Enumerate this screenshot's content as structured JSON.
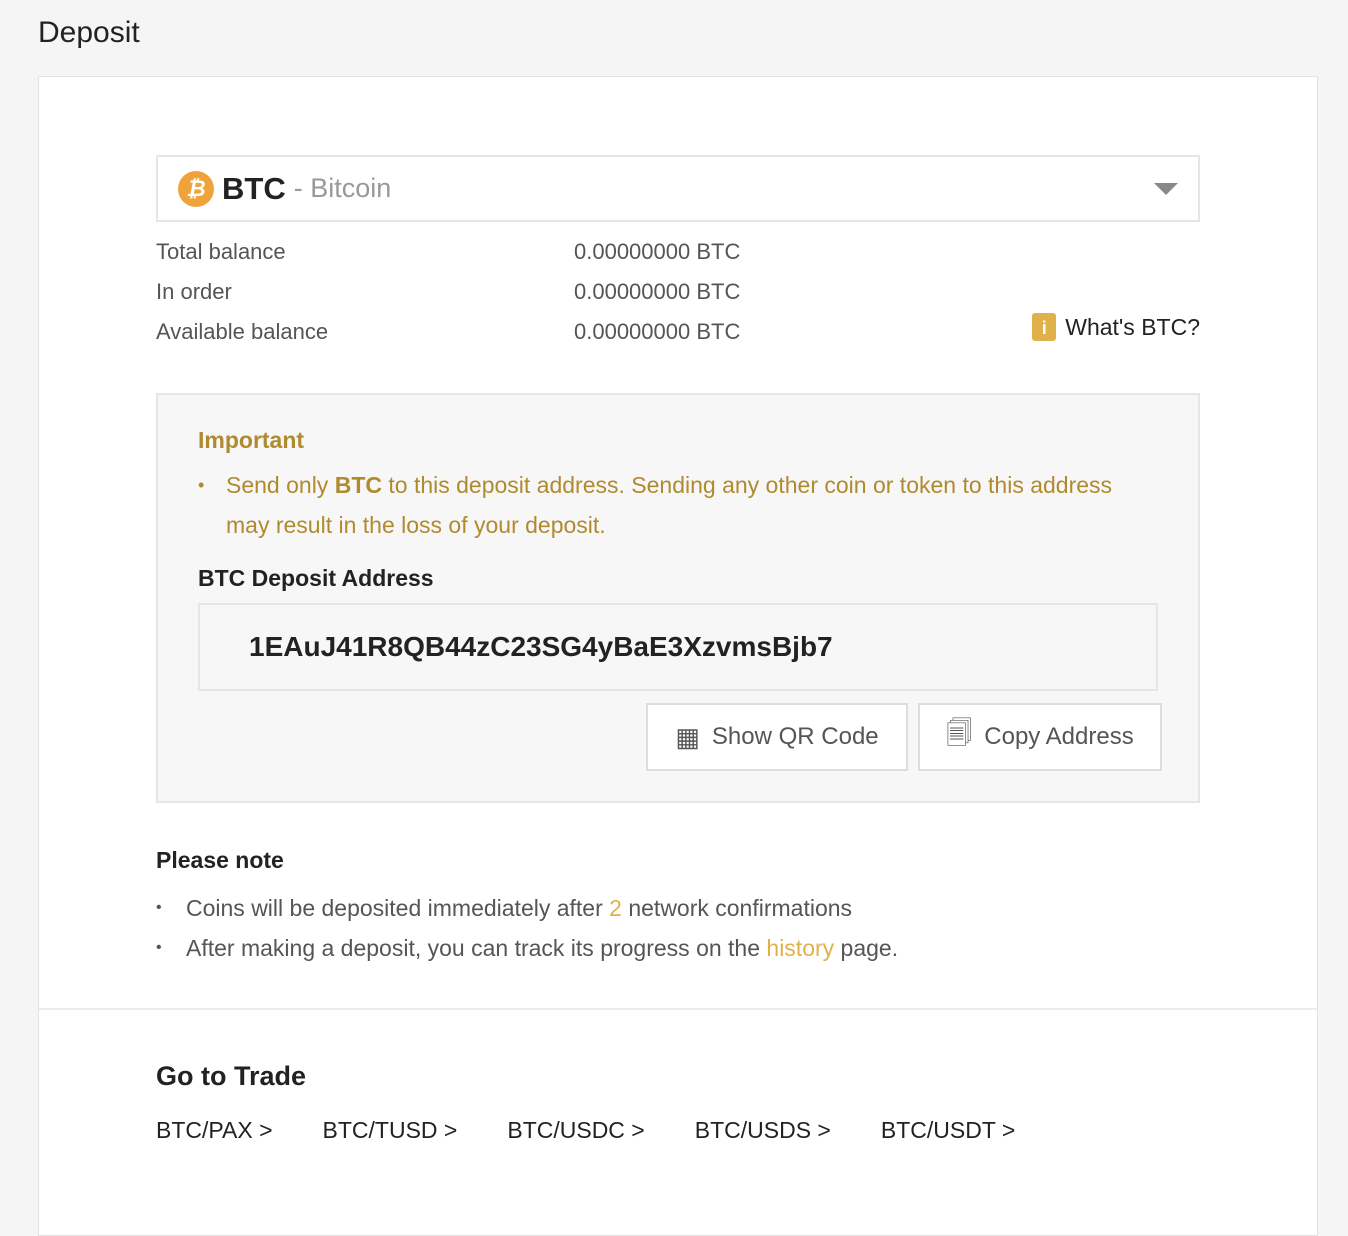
{
  "page": {
    "title": "Deposit"
  },
  "coin": {
    "symbol": "BTC",
    "name": "- Bitcoin",
    "icon": "bitcoin-icon",
    "icon_glyph": "₿"
  },
  "balances": [
    {
      "label": "Total balance",
      "value": "0.00000000 BTC"
    },
    {
      "label": "In order",
      "value": "0.00000000 BTC"
    },
    {
      "label": "Available balance",
      "value": "0.00000000 BTC"
    }
  ],
  "whats_link": "What's BTC?",
  "important": {
    "title": "Important",
    "msg_pre": "Send only ",
    "msg_coin": "BTC",
    "msg_post": " to this deposit address. Sending any other coin or token to this address may result in the loss of your deposit.",
    "address_label": "BTC Deposit Address",
    "address": "1EAuJ41R8QB44zC23SG4yBaE3XzvmsBjb7",
    "show_qr": "Show QR Code",
    "copy": "Copy Address"
  },
  "note": {
    "title": "Please note",
    "l1_pre": "Coins will be deposited immediately after ",
    "l1_num": "2",
    "l1_post": " network confirmations",
    "l2_pre": "After making a deposit, you can track its progress on the ",
    "l2_link": "history",
    "l2_post": " page."
  },
  "trade": {
    "title": "Go to Trade",
    "pairs": [
      "BTC/PAX >",
      "BTC/TUSD >",
      "BTC/USDC >",
      "BTC/USDS >",
      "BTC/USDT >"
    ]
  },
  "colors": {
    "accent": "#e0b14b",
    "warning_text": "#b08a2e",
    "coin": "#f0a33a"
  }
}
